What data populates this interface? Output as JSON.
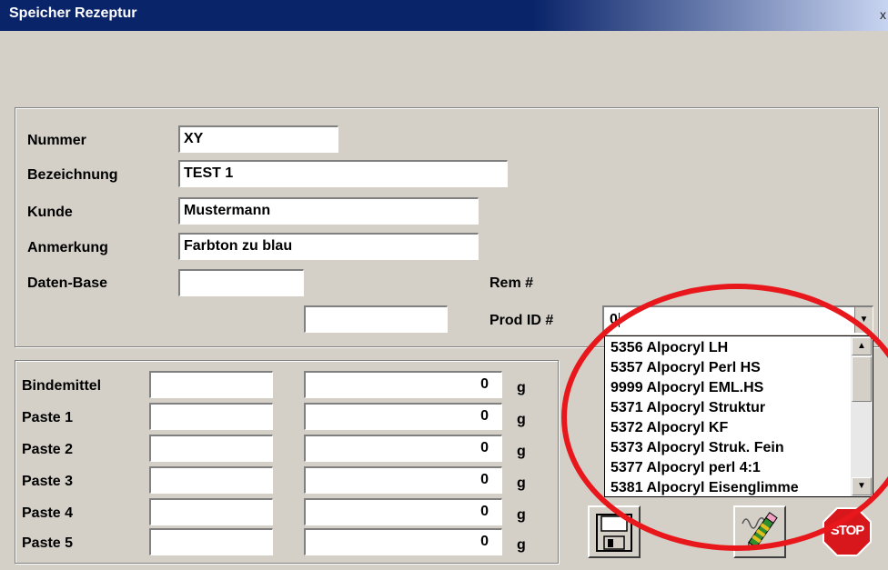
{
  "window": {
    "title": "Speicher Rezeptur",
    "close_glyph": "x"
  },
  "form": {
    "nummer": {
      "label": "Nummer",
      "value": "XY"
    },
    "bezeichnung": {
      "label": "Bezeichnung",
      "value": "TEST 1"
    },
    "kunde": {
      "label": "Kunde",
      "value": "Mustermann"
    },
    "anmerkung": {
      "label": "Anmerkung",
      "value": "Farbton zu blau"
    },
    "daten_base": {
      "label": "Daten-Base",
      "value": ""
    },
    "extra_field_value": "",
    "rem_label": "Rem #",
    "prod_id": {
      "label": "Prod ID #",
      "value": "0"
    }
  },
  "product_list": [
    "5356 Alpocryl LH",
    "5357 Alpocryl Perl HS",
    "9999 Alpocryl EML.HS",
    "5371 Alpocryl Struktur",
    "5372 Alpocryl KF",
    "5373 Alpocryl Struk. Fein",
    "5377 Alpocryl perl 4:1",
    "5381 Alpocryl Eisenglimme"
  ],
  "ingredients": {
    "unit": "g",
    "rows": [
      {
        "label": "Bindemittel",
        "name": "",
        "amount": "0"
      },
      {
        "label": "Paste 1",
        "name": "",
        "amount": "0"
      },
      {
        "label": "Paste 2",
        "name": "",
        "amount": "0"
      },
      {
        "label": "Paste 3",
        "name": "",
        "amount": "0"
      },
      {
        "label": "Paste 4",
        "name": "",
        "amount": "0"
      },
      {
        "label": "Paste 5",
        "name": "",
        "amount": "0"
      }
    ]
  },
  "toolbar": {
    "save_icon": "floppy-disk-icon",
    "edit_icon": "pencil-icon",
    "stop_label": "STOP"
  },
  "colors": {
    "titlebar": "#0a246a",
    "highlight": "#e8171c",
    "stop": "#d8171c"
  }
}
